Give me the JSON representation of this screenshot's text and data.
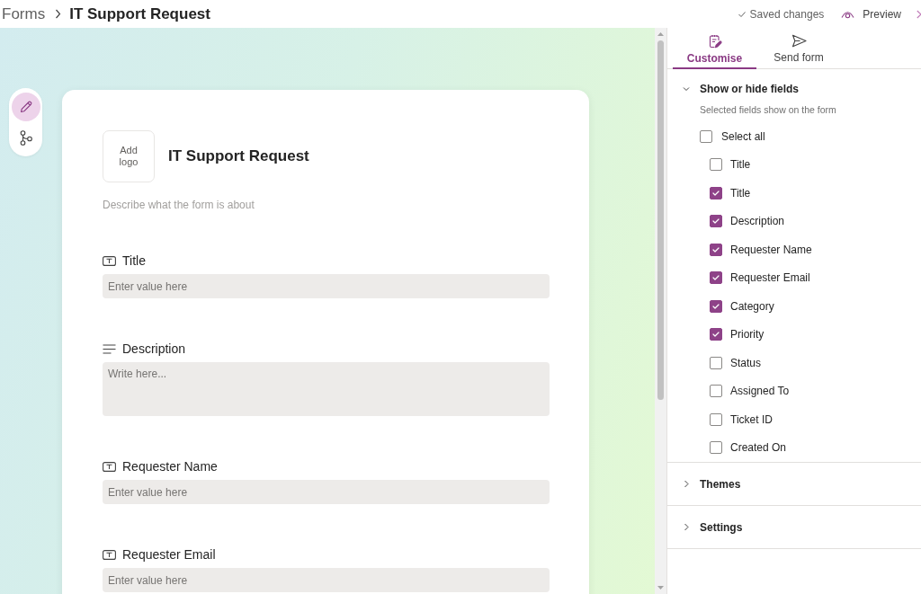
{
  "header": {
    "breadcrumb": [
      {
        "label": "Forms"
      },
      {
        "label": "IT Support Request"
      }
    ],
    "status": "Saved changes",
    "preview_button": "Preview"
  },
  "toolbar": {
    "items": [
      {
        "kind": "edit",
        "selected": true
      },
      {
        "kind": "branching",
        "selected": false
      }
    ]
  },
  "form": {
    "logo_button": "Add logo",
    "title": "IT Support Request",
    "description_placeholder": "Describe what the form is about",
    "fields": [
      {
        "kind": "text",
        "label": "Title",
        "placeholder": "Enter value here"
      },
      {
        "kind": "multiline",
        "label": "Description",
        "placeholder": "Write here..."
      },
      {
        "kind": "text",
        "label": "Requester Name",
        "placeholder": "Enter value here"
      },
      {
        "kind": "text",
        "label": "Requester Email",
        "placeholder": "Enter value here"
      }
    ]
  },
  "panel": {
    "tabs": [
      {
        "kind": "customise",
        "label": "Customise",
        "selected": true
      },
      {
        "kind": "send",
        "label": "Send form",
        "selected": false
      }
    ],
    "sections": [
      {
        "title": "Show or hide fields",
        "expanded": true,
        "hint": "Selected fields show on the form",
        "select_all": {
          "label": "Select all",
          "checked": false
        },
        "items": [
          {
            "label": "Title",
            "checked": false
          },
          {
            "label": "Title",
            "checked": true
          },
          {
            "label": "Description",
            "checked": true
          },
          {
            "label": "Requester Name",
            "checked": true
          },
          {
            "label": "Requester Email",
            "checked": true
          },
          {
            "label": "Category",
            "checked": true
          },
          {
            "label": "Priority",
            "checked": true
          },
          {
            "label": "Status",
            "checked": false
          },
          {
            "label": "Assigned To",
            "checked": false
          },
          {
            "label": "Ticket ID",
            "checked": false
          },
          {
            "label": "Created On",
            "checked": false
          }
        ]
      },
      {
        "title": "Themes",
        "expanded": false
      },
      {
        "title": "Settings",
        "expanded": false
      }
    ]
  }
}
